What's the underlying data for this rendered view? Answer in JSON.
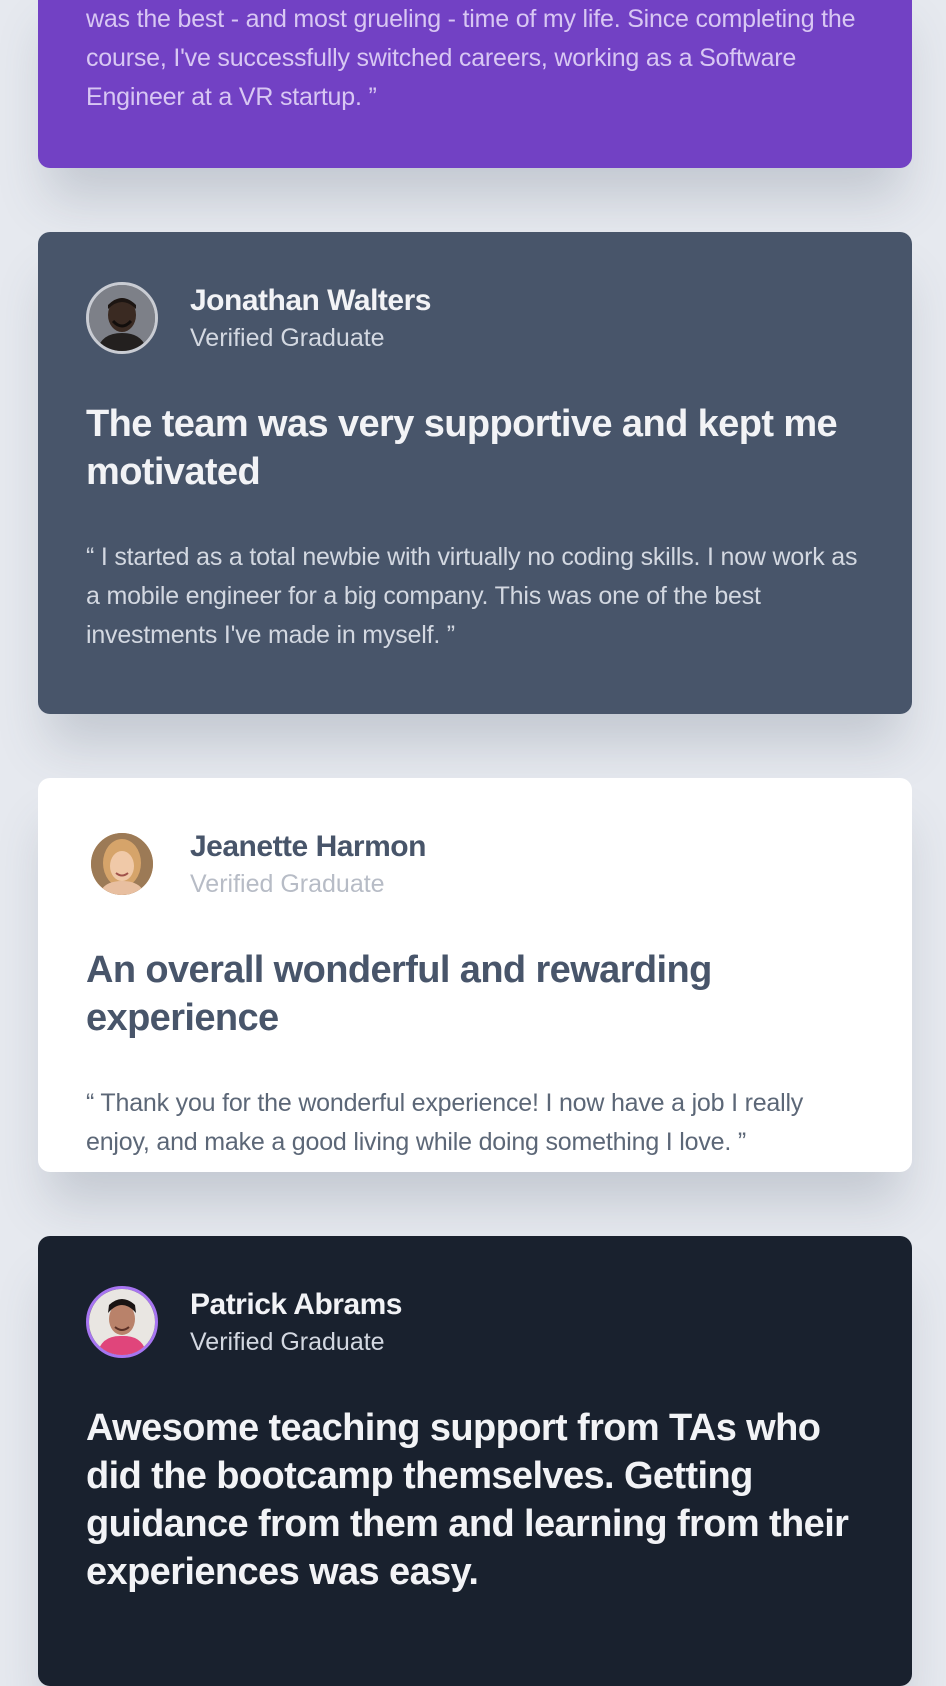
{
  "testimonials": [
    {
      "quote": "was the best - and most grueling - time of my life. Since completing the course, I've successfully switched careers, working as a Software Engineer at a VR startup. ”"
    },
    {
      "name": "Jonathan Walters",
      "role": "Verified Graduate",
      "headline": "The team was very supportive and kept me motivated",
      "quote": "“ I started as a total newbie with virtually no coding skills. I now work as a mobile engineer for a big company. This was one of the best investments I've made in myself. ”"
    },
    {
      "name": "Jeanette Harmon",
      "role": "Verified Graduate",
      "headline": "An overall wonderful and rewarding experience",
      "quote": "“ Thank you for the wonderful experience! I now have a job I really enjoy, and make a good living while doing something I love. ”"
    },
    {
      "name": "Patrick Abrams",
      "role": "Verified Graduate",
      "headline": "Awesome teaching support from TAs who did the bootcamp themselves. Getting guidance from them and learning from their experiences was easy."
    }
  ],
  "colors": {
    "page_background": "#e6e9ef",
    "purple_card": "#7241c4",
    "slate_card": "#48556a",
    "white_card": "#ffffff",
    "dark_card": "#19212e",
    "dark_avatar_ring": "#a775f1"
  },
  "icons": {
    "avatar_jonathan": "person-photo-icon",
    "avatar_jeanette": "person-photo-icon",
    "avatar_patrick": "person-photo-icon"
  }
}
